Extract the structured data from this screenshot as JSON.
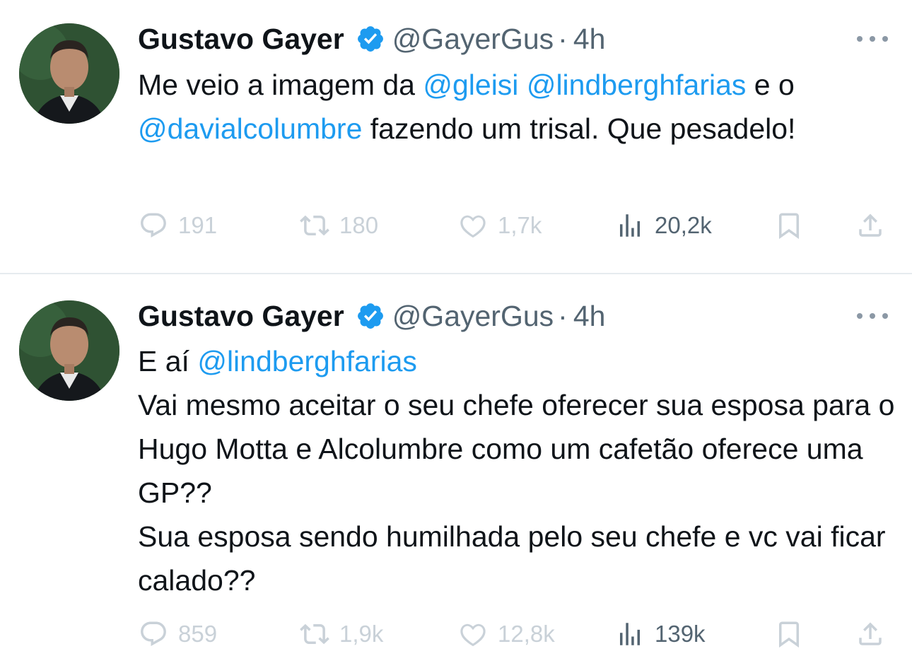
{
  "tweets": [
    {
      "author": {
        "name": "Gustavo Gayer",
        "handle": "@GayerGus",
        "time": "4h"
      },
      "text_segments": [
        {
          "t": "Me veio a imagem da ",
          "mention": false
        },
        {
          "t": "@gleisi",
          "mention": true
        },
        {
          "t": " ",
          "mention": false
        },
        {
          "t": "@lindberghfarias",
          "mention": true
        },
        {
          "t": " e o ",
          "mention": false
        },
        {
          "t": "@davialcolumbre",
          "mention": true
        },
        {
          "t": " fazendo um trisal. Que pesadelo!",
          "mention": false
        }
      ],
      "stats": {
        "replies": "191",
        "retweets": "180",
        "likes": "1,7k",
        "views": "20,2k"
      }
    },
    {
      "author": {
        "name": "Gustavo Gayer",
        "handle": "@GayerGus",
        "time": "4h"
      },
      "text_segments": [
        {
          "t": "E aí ",
          "mention": false
        },
        {
          "t": "@lindberghfarias",
          "mention": true
        },
        {
          "t": "\nVai mesmo aceitar o seu chefe oferecer sua esposa para o Hugo Motta e Alcolumbre como um cafetão oferece uma GP??\nSua esposa sendo humilhada pelo seu chefe e vc vai ficar calado??",
          "mention": false
        }
      ],
      "stats": {
        "replies": "859",
        "retweets": "1,9k",
        "likes": "12,8k",
        "views": "139k"
      }
    }
  ],
  "icons": {
    "verified": "verified-badge-icon",
    "more": "more-options-icon",
    "reply": "reply-icon",
    "retweet": "retweet-icon",
    "like": "heart-icon",
    "views": "views-chart-icon",
    "bookmark": "bookmark-icon",
    "share": "share-icon"
  },
  "colors": {
    "mention": "#1d9bf0",
    "muted": "#536471",
    "faded": "#c9d1d8",
    "verified": "#1d9bf0"
  }
}
